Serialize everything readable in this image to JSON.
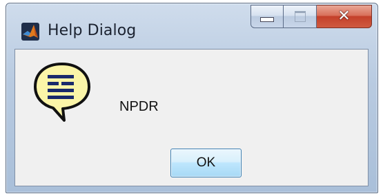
{
  "window": {
    "title": "Help Dialog",
    "app_icon": "matlab-icon"
  },
  "title_controls": {
    "minimize_icon": "minimize-icon",
    "maximize_icon": "maximize-icon",
    "close_icon": "close-icon",
    "close_color": "#c4402a"
  },
  "dialog": {
    "icon": "help-speech-bubble-icon",
    "message": "NPDR",
    "ok_label": "OK"
  }
}
